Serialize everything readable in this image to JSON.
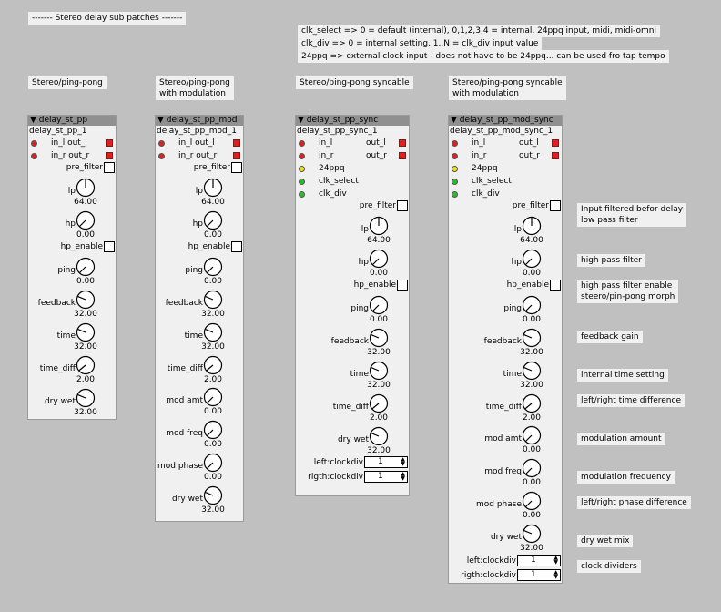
{
  "title_comment": "------- Stereo delay sub patches -------",
  "info_comments": [
    "clk_select => 0 = default (internal), 0,1,2,3,4 = internal, 24ppq input, midi, midi-omni",
    "clk_div => 0 = internal setting, 1..N = clk_div input value",
    "24ppq => external clock input - does not have to be 24ppq... can be used fro tap tempo"
  ],
  "columns": [
    {
      "heading": "Stereo/ping-pong"
    },
    {
      "heading": "Stereo/ping-pong\nwith modulation"
    },
    {
      "heading": "Stereo/ping-pong syncable"
    },
    {
      "heading": "Stereo/ping-pong syncable\nwith modulation"
    }
  ],
  "objects": [
    {
      "type": "delay_st_pp",
      "instance": "delay_st_pp_1"
    },
    {
      "type": "delay_st_pp_mod",
      "instance": "delay_st_pp_mod_1"
    },
    {
      "type": "delay_st_pp_sync",
      "instance": "delay_st_pp_sync_1"
    },
    {
      "type": "delay_st_pp_mod_sync",
      "instance": "delay_st_pp_mod_sync_1"
    }
  ],
  "ports": {
    "in_l": "in_l",
    "in_r": "in_r",
    "out_l": "out_l",
    "out_r": "out_r",
    "ppq": "24ppq",
    "clk_select": "clk_select",
    "clk_div": "clk_div",
    "in_l_out_l": "in_l out_l",
    "in_r_out_r": "in_r out_r"
  },
  "params": {
    "pre_filter": "pre_filter",
    "lp": "lp",
    "hp": "hp",
    "hp_enable": "hp_enable",
    "ping": "ping",
    "feedback": "feedback",
    "time": "time",
    "time_diff": "time_diff",
    "mod_amt": "mod amt",
    "mod_freq": "mod freq",
    "mod_phase": "mod phase",
    "dry_wet": "dry wet",
    "left_clockdiv": "left:clockdiv",
    "right_clockdiv": "rigth:clockdiv"
  },
  "values": {
    "lp": "64.00",
    "hp": "0.00",
    "ping": "0.00",
    "feedback": "32.00",
    "time": "32.00",
    "time_diff": "2.00",
    "mod_amt": "0.00",
    "mod_freq": "0.00",
    "mod_phase": "0.00",
    "dry_wet": "32.00",
    "clockdiv": "1"
  },
  "annotations": {
    "input_filtered": "Input filtered befor delay\nlow pass filter",
    "high_pass": "high pass filter",
    "hp_enable": "high pass filter enable\nsteero/pin-pong morph",
    "feedback_gain": "feedback gain",
    "internal_time": "internal time setting",
    "lr_time_diff": "left/right time difference",
    "mod_amount": "modulation amount",
    "mod_frequency": "modulation frequency",
    "lr_phase_diff": "left/right phase difference",
    "dry_wet_mix": "dry wet mix",
    "clock_dividers": "clock dividers"
  },
  "knob_levels": {
    "lp": 0.5,
    "hp": 0.0,
    "ping": 0.0,
    "feedback": 0.25,
    "time": 0.25,
    "time_diff": 0.02,
    "mod_amt": 0.0,
    "mod_freq": 0.0,
    "mod_phase": 0.0,
    "dry_wet": 0.25
  },
  "colors": {
    "background": "#c0c0c0",
    "panel": "#f0f0f0",
    "header": "#909090",
    "audio_port": "#e02020",
    "ppq_port": "#f0e020",
    "control_port": "#28c028"
  }
}
